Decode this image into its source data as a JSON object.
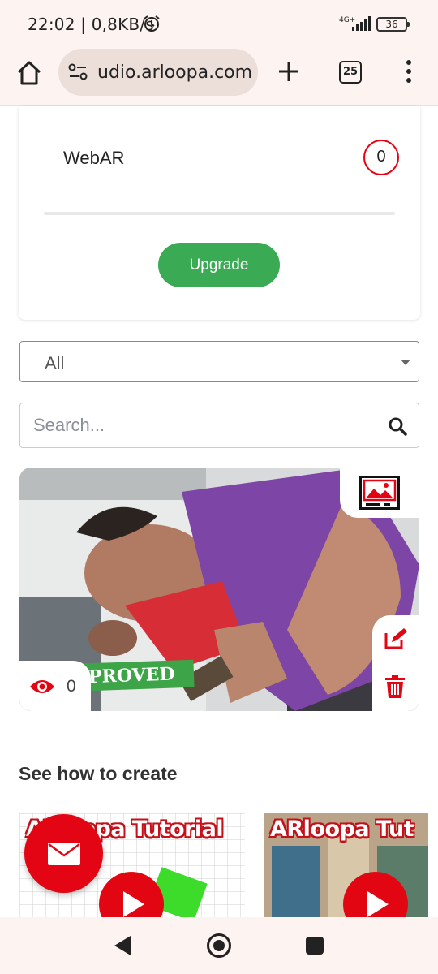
{
  "status_bar": {
    "time_speed": "22:02 | 0,8KB/s",
    "network": "4G+",
    "battery": "36"
  },
  "browser": {
    "url": "udio.arloopa.com",
    "tab_count": "25"
  },
  "plan_card": {
    "webar_label": "WebAR",
    "webar_count": "0",
    "usage_fraction": 0,
    "upgrade_label": "Upgrade"
  },
  "filter": {
    "selected": "All"
  },
  "search": {
    "placeholder": "Search..."
  },
  "project": {
    "type_icon": "image-icon",
    "status_stamp": "PROVED",
    "views": "0"
  },
  "tutorials": {
    "section_title": "See how to create",
    "items": [
      {
        "title": "ARloopa Tutorial"
      },
      {
        "title": "ARloopa Tut"
      }
    ]
  },
  "colors": {
    "accent_red": "#e30513",
    "upgrade_green": "#3aaa55",
    "chrome_bg": "#fdf3f0"
  }
}
